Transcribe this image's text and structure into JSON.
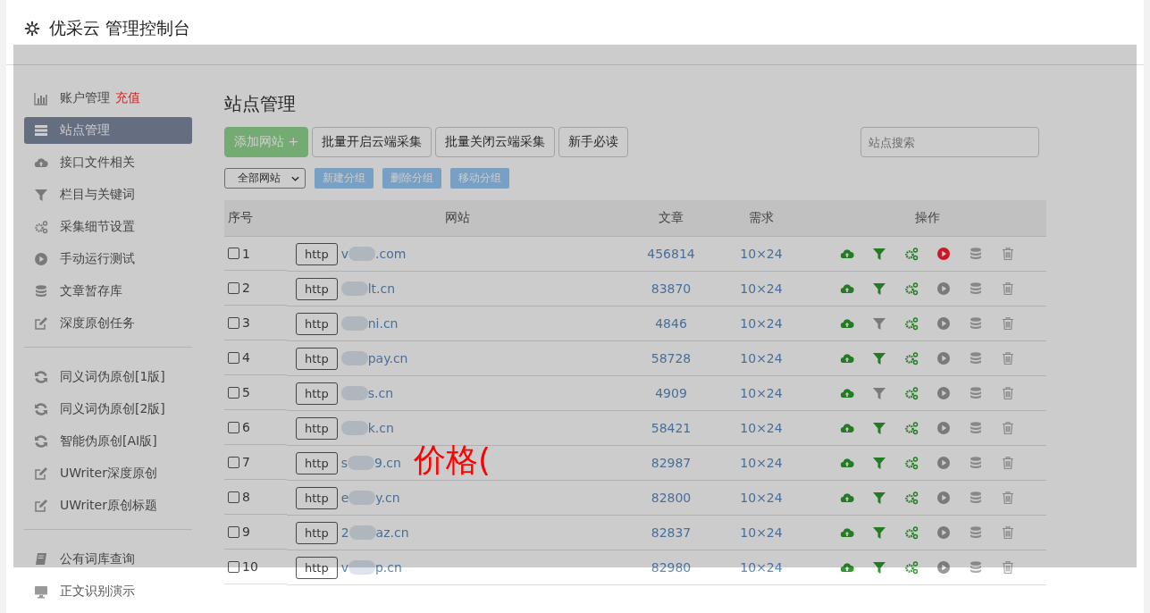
{
  "window": {
    "title": "优采云 管理控制台"
  },
  "sidebar": {
    "groups": [
      {
        "items": [
          {
            "label": "账户管理",
            "kind": "chart",
            "selected": false,
            "badge": "充值"
          },
          {
            "label": "站点管理",
            "kind": "list",
            "selected": true
          },
          {
            "label": "接口文件相关",
            "kind": "cloud",
            "selected": false
          },
          {
            "label": "栏目与关键词",
            "kind": "filter",
            "selected": false
          },
          {
            "label": "采集细节设置",
            "kind": "gears",
            "selected": false
          },
          {
            "label": "手动运行测试",
            "kind": "play",
            "selected": false
          },
          {
            "label": "文章暂存库",
            "kind": "database",
            "selected": false
          },
          {
            "label": "深度原创任务",
            "kind": "edit",
            "selected": false
          }
        ]
      },
      {
        "items": [
          {
            "label": "同义词伪原创[1版]",
            "kind": "refresh",
            "selected": false
          },
          {
            "label": "同义词伪原创[2版]",
            "kind": "refresh",
            "selected": false
          },
          {
            "label": "智能伪原创[AI版]",
            "kind": "refresh",
            "selected": false
          },
          {
            "label": "UWriter深度原创",
            "kind": "edit",
            "selected": false
          },
          {
            "label": "UWriter原创标题",
            "kind": "edit",
            "selected": false
          }
        ]
      },
      {
        "items": [
          {
            "label": "公有词库查询",
            "kind": "book",
            "selected": false
          },
          {
            "label": "正文识别演示",
            "kind": "monitor",
            "selected": false
          }
        ]
      }
    ]
  },
  "main": {
    "title": "站点管理",
    "toolbar": [
      {
        "label": "添加网站 +",
        "kind": "primary"
      },
      {
        "label": "批量开启云端采集",
        "kind": "default"
      },
      {
        "label": "批量关闭云端采集",
        "kind": "default"
      },
      {
        "label": "新手必读",
        "kind": "default"
      }
    ],
    "search": {
      "placeholder": "站点搜索"
    },
    "group_select": {
      "value": "全部网站"
    },
    "group_buttons": [
      "新建分组",
      "删除分组",
      "移动分组"
    ],
    "table": {
      "columns": [
        "序号",
        "网站",
        "文章",
        "需求",
        "操作"
      ],
      "rows": [
        {
          "index": "1",
          "checked": false,
          "protocol": "http",
          "site_head": "v",
          "site_tail": ".com",
          "articles": "456814",
          "demand": "10×24",
          "filter_on": true,
          "running": true
        },
        {
          "index": "2",
          "checked": false,
          "protocol": "http",
          "site_tail": "lt.cn",
          "articles": "83870",
          "demand": "10×24",
          "filter_on": true,
          "running": false
        },
        {
          "index": "3",
          "checked": false,
          "protocol": "http",
          "site_tail": "ni.cn",
          "articles": "4846",
          "demand": "10×24",
          "filter_on": false,
          "running": false
        },
        {
          "index": "4",
          "checked": false,
          "protocol": "http",
          "site_tail": "pay.cn",
          "articles": "58728",
          "demand": "10×24",
          "filter_on": true,
          "running": false
        },
        {
          "index": "5",
          "checked": false,
          "protocol": "http",
          "site_tail": "s.cn",
          "articles": "4909",
          "demand": "10×24",
          "filter_on": false,
          "running": false
        },
        {
          "index": "6",
          "checked": false,
          "protocol": "http",
          "site_tail": "k.cn",
          "articles": "58421",
          "demand": "10×24",
          "filter_on": true,
          "running": false
        },
        {
          "index": "7",
          "checked": false,
          "protocol": "http",
          "site_head": "s",
          "site_tail": "9.cn",
          "articles": "82987",
          "demand": "10×24",
          "filter_on": true,
          "running": false
        },
        {
          "index": "8",
          "checked": false,
          "protocol": "http",
          "site_head": "e",
          "site_tail": "y.cn",
          "articles": "82800",
          "demand": "10×24",
          "filter_on": true,
          "running": false
        },
        {
          "index": "9",
          "checked": false,
          "protocol": "http",
          "site_head": "2",
          "site_tail": "az.cn",
          "articles": "82837",
          "demand": "10×24",
          "filter_on": true,
          "running": false
        },
        {
          "index": "10",
          "checked": false,
          "protocol": "http",
          "site_head": "v",
          "site_tail": "p.cn",
          "articles": "82980",
          "demand": "10×24",
          "filter_on": true,
          "running": false
        }
      ]
    }
  },
  "overlay_text": "价格("
}
